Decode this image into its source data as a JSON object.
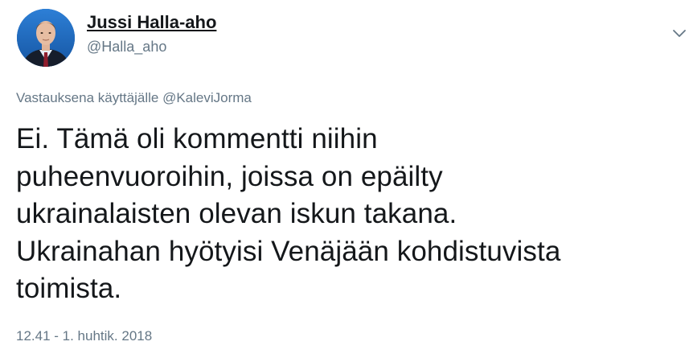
{
  "author": {
    "display_name": "Jussi Halla-aho",
    "handle": "@Halla_aho",
    "avatar_icon": "profile-photo"
  },
  "menu": {
    "caret_icon": "chevron-down-icon"
  },
  "reply_context": {
    "prefix": "Vastauksena käyttäjälle ",
    "mention": "@KaleviJorma"
  },
  "tweet": {
    "lines": [
      "Ei. Tämä oli kommentti niihin",
      "puheenvuoroihin, joissa on epäilty",
      "ukrainalaisten olevan iskun takana.",
      "Ukrainahan hyötyisi Venäjään kohdistuvista",
      "toimista."
    ],
    "timestamp": "12.41 - 1. huhtik. 2018"
  },
  "colors": {
    "text": "#14171a",
    "secondary": "#657786",
    "background": "#ffffff"
  }
}
